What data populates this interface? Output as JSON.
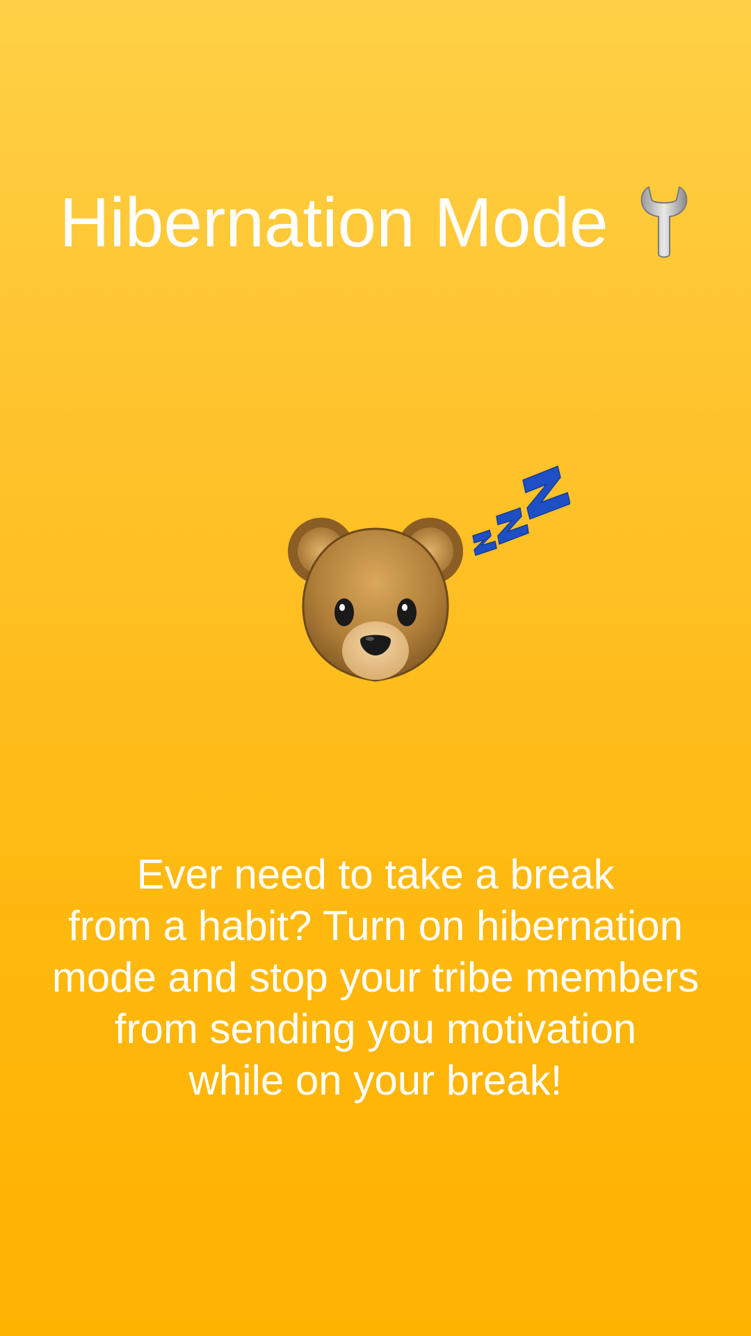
{
  "header": {
    "title": "Hibernation Mode",
    "title_icon": "wrench-icon"
  },
  "illustration": {
    "icons": [
      "sleeping-bear-icon",
      "zzz-icon"
    ]
  },
  "body": {
    "description": "Ever need to take a break\nfrom a habit? Turn on hibernation\nmode and stop your tribe members\nfrom sending you motivation\nwhile on your break!"
  },
  "colors": {
    "background_top": "#FFD046",
    "background_bottom": "#FFB200",
    "text": "#FFFFFF",
    "zzz": "#1F4FC4"
  }
}
